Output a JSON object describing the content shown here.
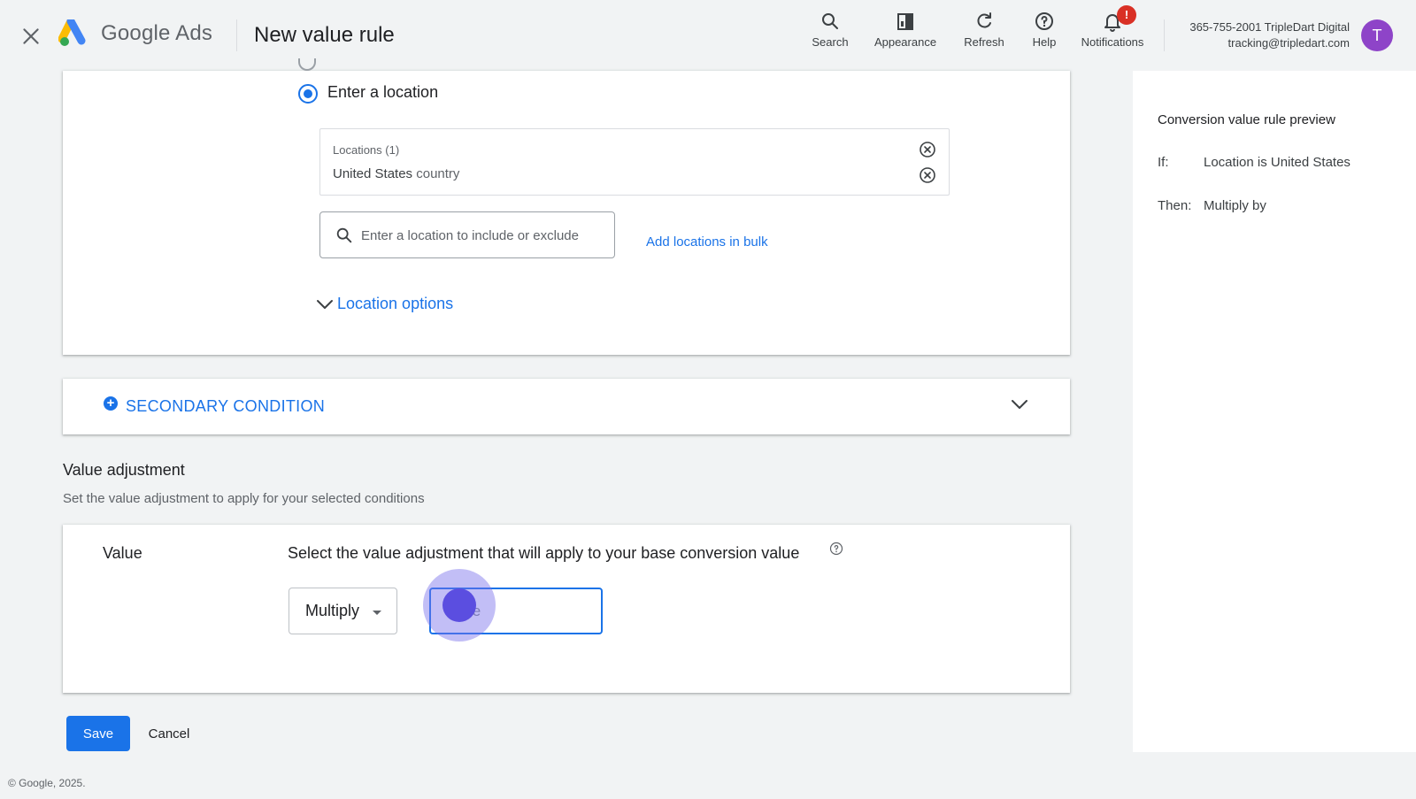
{
  "header": {
    "brand": "Google Ads",
    "title": "New value rule",
    "tools": {
      "search": "Search",
      "appearance": "Appearance",
      "refresh": "Refresh",
      "help": "Help",
      "notifications": "Notifications",
      "notifications_badge": "!"
    },
    "account": {
      "line1": "365-755-2001 TripleDart Digital",
      "line2": "tracking@tripledart.com",
      "avatar_letter": "T"
    }
  },
  "location_section": {
    "radio_label": "Enter a location",
    "locations_title": "Locations (1)",
    "location_name": "United States",
    "location_type": "country",
    "search_placeholder": "Enter a location to include or exclude",
    "bulk_link": "Add locations in bulk",
    "options_label": "Location options"
  },
  "secondary_condition": {
    "label": "SECONDARY CONDITION"
  },
  "value_adjustment": {
    "title": "Value adjustment",
    "description": "Set the value adjustment to apply for your selected conditions",
    "value_label": "Value",
    "instruction": "Select the value adjustment that will apply to your base conversion value",
    "operation": "Multiply",
    "input_placeholder": "Value"
  },
  "actions": {
    "save": "Save",
    "cancel": "Cancel"
  },
  "footer": "© Google, 2025.",
  "preview": {
    "title": "Conversion value rule preview",
    "if_label": "If:",
    "if_value": "Location is United States",
    "then_label": "Then:",
    "then_value": "Multiply by"
  },
  "colors": {
    "accent": "#1a73e8",
    "badge": "#d93025",
    "avatar": "#8e44c8",
    "background": "#f1f3f4"
  }
}
